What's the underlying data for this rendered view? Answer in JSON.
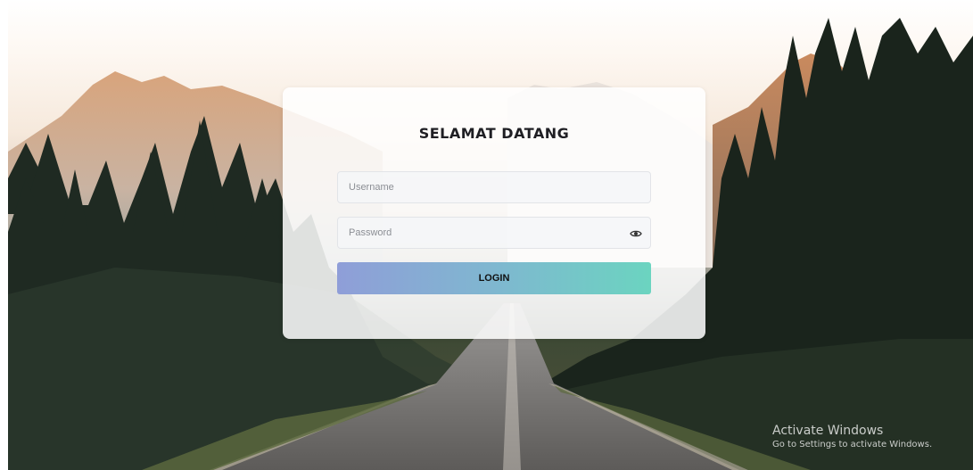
{
  "login": {
    "title": "SELAMAT DATANG",
    "username_placeholder": "Username",
    "password_placeholder": "Password",
    "button_label": "LOGIN",
    "password_toggle_icon": "eye-icon"
  },
  "watermark": {
    "title": "Activate Windows",
    "subtitle": "Go to Settings to activate Windows."
  },
  "colors": {
    "button_gradient_start": "#8f9ed8",
    "button_gradient_end": "#6bd4c0",
    "title_text": "#1f1f24",
    "card_background": "#ffffff"
  }
}
